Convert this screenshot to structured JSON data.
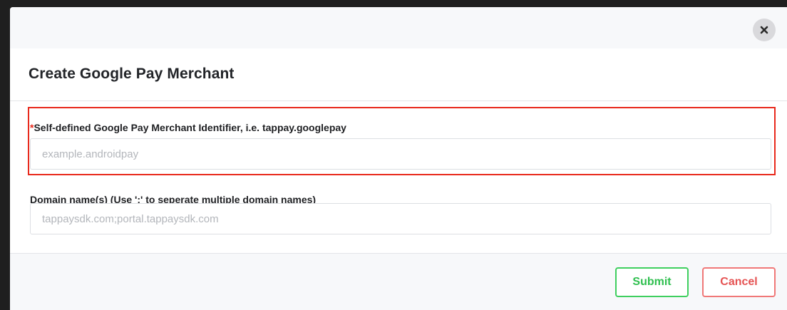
{
  "modal": {
    "title": "Create Google Pay Merchant",
    "close_icon": "close-icon"
  },
  "fields": {
    "merchant_identifier": {
      "required_marker": "*",
      "label": "Self-defined Google Pay Merchant Identifier, i.e. tappay.googlepay",
      "value": "",
      "placeholder": "example.androidpay",
      "highlighted": true
    },
    "domain_names": {
      "label": "Domain name(s) (Use ';' to seperate multiple domain names)",
      "value": "",
      "placeholder": "tappaysdk.com;portal.tappaysdk.com"
    }
  },
  "footer": {
    "submit_label": "Submit",
    "cancel_label": "Cancel"
  },
  "colors": {
    "highlight": "#e8291c",
    "submit": "#2fbf4f",
    "cancel": "#e55353"
  }
}
